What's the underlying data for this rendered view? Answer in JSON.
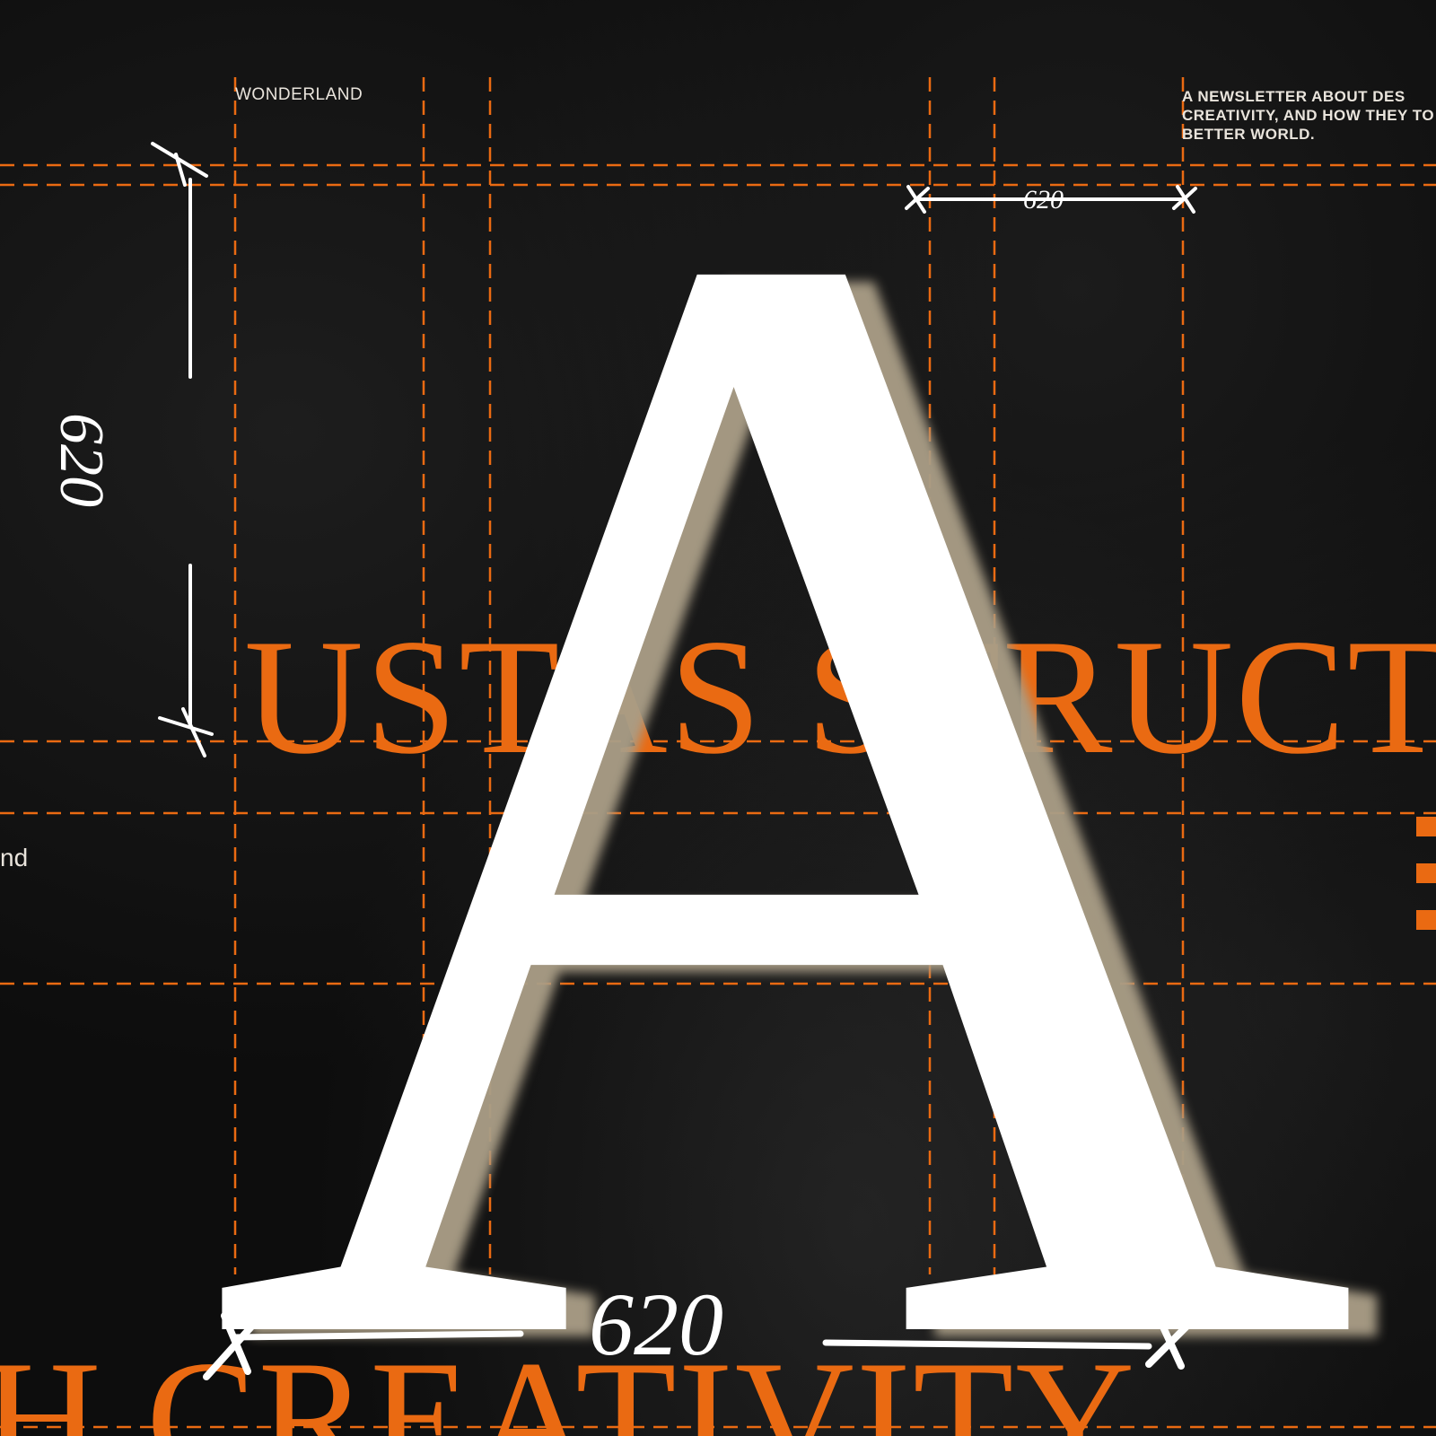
{
  "header": {
    "brand": "WONDERLAND",
    "tagline": "A NEWSLETTER ABOUT DES CREATIVITY, AND HOW THEY TO A BETTER WORLD."
  },
  "headline": {
    "line1": "USTAS STRUCTUN",
    "line2": "H CREATIVITY"
  },
  "body_fragment": "nd",
  "glyph": "A",
  "measurements": {
    "top": "620",
    "left": "620",
    "bottom": "620"
  },
  "colors": {
    "background": "#0d0d0d",
    "accent_orange": "#ea6a12",
    "glyph_white": "#ffffff",
    "glyph_shadow": "#a99d86",
    "text_light": "#e9e4dc"
  }
}
